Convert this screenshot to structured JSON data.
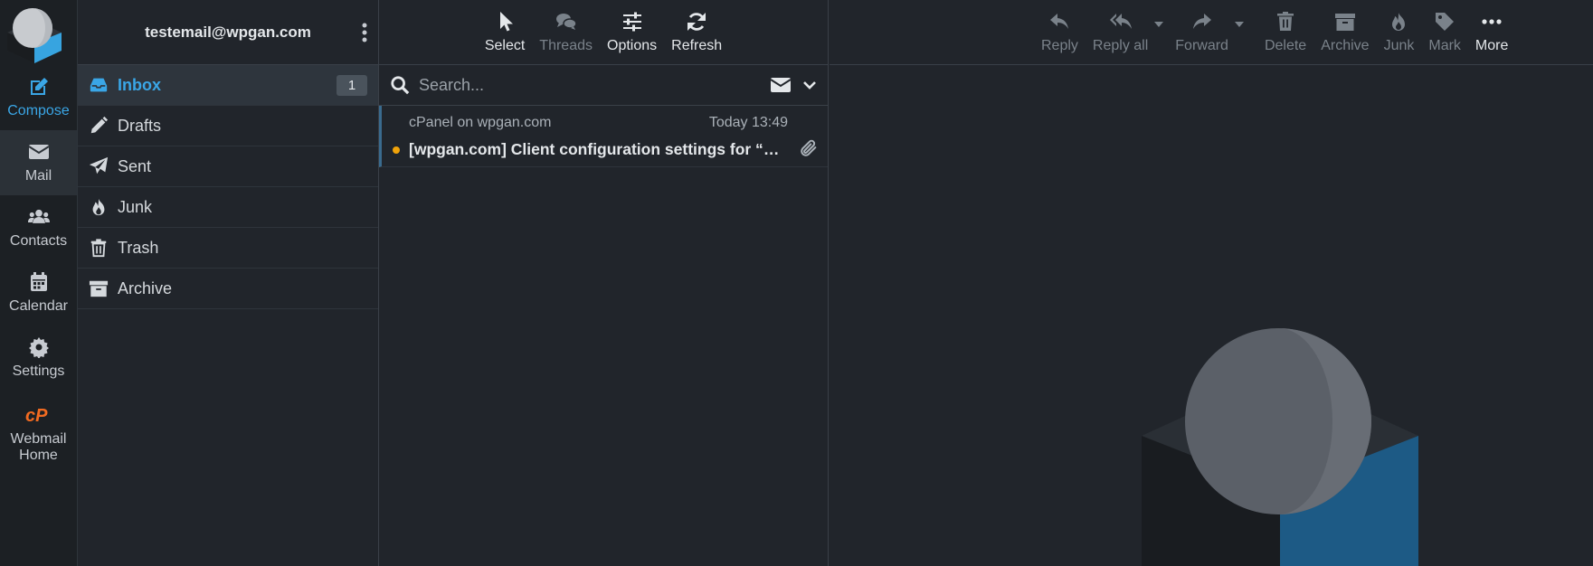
{
  "account": {
    "email": "testemail@wpgan.com"
  },
  "taskbar": {
    "items": [
      {
        "label": "Compose",
        "icon": "compose-icon"
      },
      {
        "label": "Mail",
        "icon": "envelope-icon"
      },
      {
        "label": "Contacts",
        "icon": "users-icon"
      },
      {
        "label": "Calendar",
        "icon": "calendar-icon"
      },
      {
        "label": "Settings",
        "icon": "gear-icon"
      },
      {
        "label": "Webmail\nHome",
        "icon": "cpanel-icon"
      }
    ]
  },
  "folders": {
    "items": [
      {
        "label": "Inbox",
        "icon": "inbox-icon",
        "count": "1"
      },
      {
        "label": "Drafts",
        "icon": "pencil-icon"
      },
      {
        "label": "Sent",
        "icon": "paper-plane-icon"
      },
      {
        "label": "Junk",
        "icon": "fire-icon"
      },
      {
        "label": "Trash",
        "icon": "trash-icon"
      },
      {
        "label": "Archive",
        "icon": "archive-icon"
      }
    ]
  },
  "list_toolbar": {
    "select": "Select",
    "threads": "Threads",
    "options": "Options",
    "refresh": "Refresh"
  },
  "search": {
    "placeholder": "Search..."
  },
  "messages": [
    {
      "from": "cPanel on wpgan.com",
      "date": "Today 13:49",
      "subject": "[wpgan.com] Client configuration settings for “testemail@wpgan.com”."
    }
  ],
  "reader_toolbar": {
    "reply": "Reply",
    "reply_all": "Reply all",
    "forward": "Forward",
    "delete": "Delete",
    "archive": "Archive",
    "junk": "Junk",
    "mark": "Mark",
    "more": "More"
  },
  "colors": {
    "accent": "#3aa6e6",
    "background": "#21252b",
    "unread_dot": "#f0a30a"
  }
}
